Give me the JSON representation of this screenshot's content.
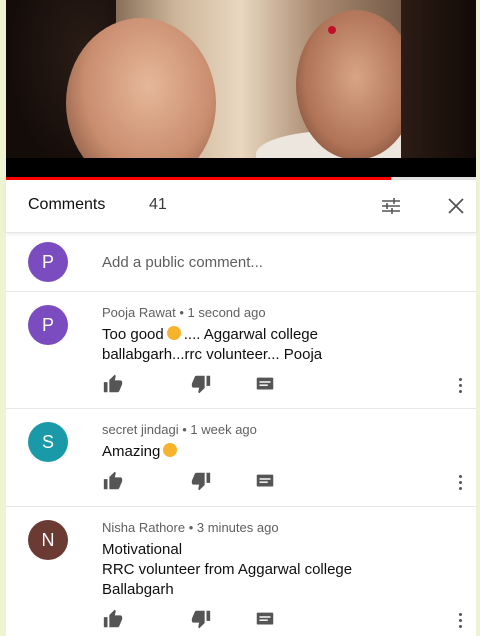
{
  "video": {
    "progress_fraction": 0.82
  },
  "comments_panel": {
    "title": "Comments",
    "count": "41",
    "add_comment": {
      "avatar_letter": "P",
      "avatar_color": "#7a4cc0",
      "placeholder": "Add a public comment..."
    },
    "comments": [
      {
        "avatar_letter": "P",
        "avatar_color": "#7a4cc0",
        "author": "Pooja Rawat",
        "time": "1 second ago",
        "text_before": "Too good",
        "text_after": ".... Aggarwal college",
        "text_line2": "ballabgarh...rrc volunteer... Pooja",
        "emoji": "ok-hand-emoji"
      },
      {
        "avatar_letter": "S",
        "avatar_color": "#1a9aa8",
        "author": "secret jindagi",
        "time": "1 week ago",
        "text_before": "Amazing",
        "emoji": "ok-hand-emoji"
      },
      {
        "avatar_letter": "N",
        "avatar_color": "#6b3a33",
        "author": "Nisha Rathore",
        "time": "3 minutes ago",
        "text_line1": "Motivational",
        "text_line2": "RRC volunteer from Aggarwal college",
        "text_line3": "Ballabgarh"
      }
    ]
  },
  "icons": {
    "filter": "sort-filter-icon",
    "close": "close-icon",
    "like": "thumbs-up-icon",
    "dislike": "thumbs-down-icon",
    "reply": "reply-icon",
    "more": "more-vert-icon"
  },
  "colors": {
    "progress": "#ff0000",
    "bg": "#eef3d0"
  }
}
